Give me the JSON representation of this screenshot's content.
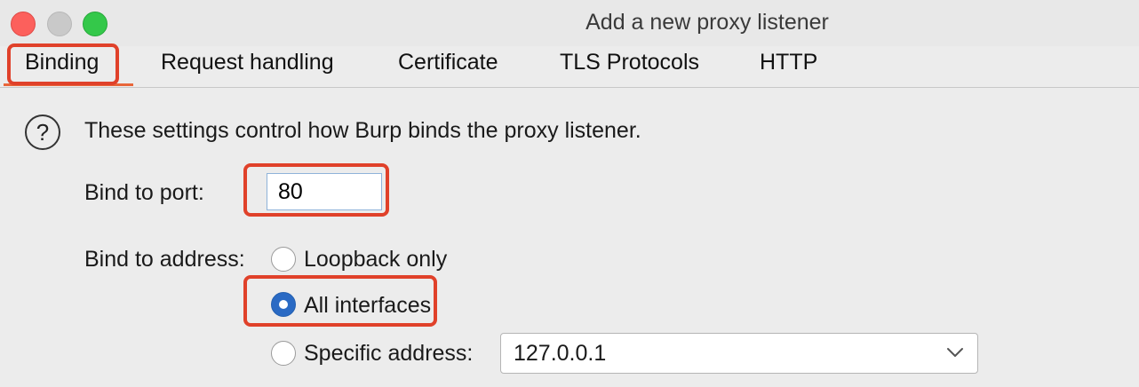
{
  "window": {
    "title": "Add a new proxy listener"
  },
  "tabs": [
    {
      "label": "Binding",
      "active": true
    },
    {
      "label": "Request handling",
      "active": false
    },
    {
      "label": "Certificate",
      "active": false
    },
    {
      "label": "TLS Protocols",
      "active": false
    },
    {
      "label": "HTTP",
      "active": false
    }
  ],
  "binding": {
    "help_icon": "question-mark-icon",
    "description": "These settings control how Burp binds the proxy listener.",
    "port_label": "Bind to port:",
    "port_value": "80",
    "address_label": "Bind to address:",
    "options": [
      {
        "label": "Loopback only",
        "selected": false
      },
      {
        "label": "All interfaces",
        "selected": true
      },
      {
        "label": "Specific address:",
        "selected": false
      }
    ],
    "specific_address_value": "127.0.0.1"
  },
  "colors": {
    "highlight": "#e0412a",
    "accent": "#e8663a",
    "radio_selected": "#2a6ac4"
  }
}
